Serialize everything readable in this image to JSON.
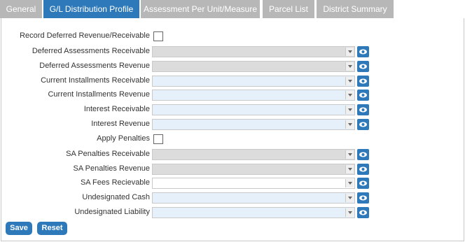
{
  "tabs": [
    {
      "label": "General",
      "active": false
    },
    {
      "label": "G/L Distribution Profile",
      "active": true
    },
    {
      "label": "Assessment Per Unit/Measure",
      "active": false
    },
    {
      "label": "Parcel List",
      "active": false
    },
    {
      "label": "District Summary",
      "active": false
    }
  ],
  "form": {
    "record_deferred_label": "Record Deferred Revenue/Receivable",
    "record_deferred_checked": false,
    "deferred_assessments_receivable_label": "Deferred Assessments Receivable",
    "deferred_assessments_revenue_label": "Deferred Assessments Revenue",
    "current_installments_receivable_label": "Current Installments Receivable",
    "current_installments_revenue_label": "Current Installments Revenue",
    "interest_receivable_label": "Interest Receivable",
    "interest_revenue_label": "Interest Revenue",
    "apply_penalties_label": "Apply Penalties",
    "apply_penalties_checked": false,
    "sa_penalties_receivable_label": "SA Penalties Receivable",
    "sa_penalties_revenue_label": "SA Penalties Revenue",
    "sa_fees_receivable_label": "SA Fees Recievable",
    "undesignated_cash_label": "Undesignated Cash",
    "undesignated_liability_label": "Undesignated Liability"
  },
  "buttons": {
    "save_label": "Save",
    "reset_label": "Reset"
  },
  "colors": {
    "accent": "#2e79b9",
    "inactive_tab": "#b7b7b7",
    "disabled_field": "#dcdcdc",
    "enabled_field": "#e6f0fa"
  },
  "icons": {
    "lookup": "eye-icon",
    "dropdown": "chevron-down-icon"
  }
}
